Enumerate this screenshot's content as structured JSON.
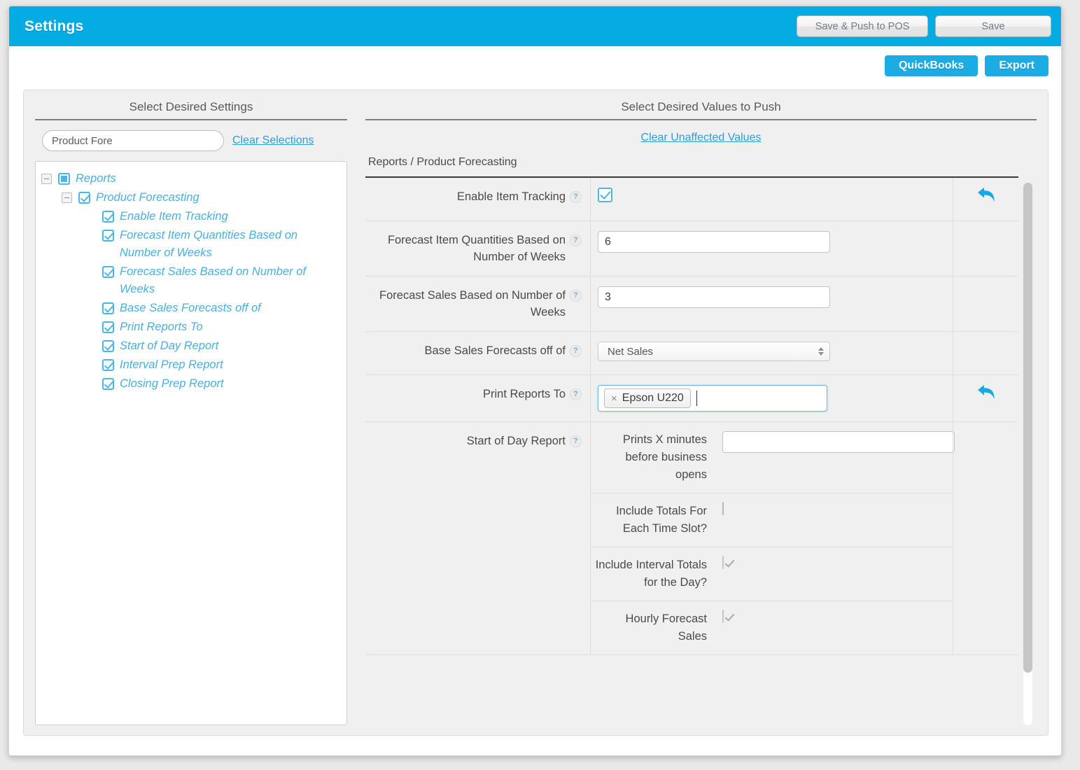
{
  "titlebar": {
    "title": "Settings",
    "save_push_label": "Save & Push to POS",
    "save_label": "Save"
  },
  "subbar": {
    "quickbooks_label": "QuickBooks",
    "export_label": "Export"
  },
  "left": {
    "heading": "Select Desired Settings",
    "search_value": "Product Fore",
    "search_placeholder": "Search settings",
    "clear_selections_label": "Clear Selections",
    "tree": [
      {
        "label": "Reports",
        "depth": 0,
        "state": "partial",
        "expander": "collapse"
      },
      {
        "label": "Product Forecasting",
        "depth": 1,
        "state": "checked",
        "expander": "collapse"
      },
      {
        "label": "Enable Item Tracking",
        "depth": 2,
        "state": "checked",
        "expander": "none"
      },
      {
        "label": "Forecast Item Quantities Based on Number of Weeks",
        "depth": 2,
        "state": "checked",
        "expander": "none"
      },
      {
        "label": "Forecast Sales Based on Number of Weeks",
        "depth": 2,
        "state": "checked",
        "expander": "none"
      },
      {
        "label": "Base Sales Forecasts off of",
        "depth": 2,
        "state": "checked",
        "expander": "none"
      },
      {
        "label": "Print Reports To",
        "depth": 2,
        "state": "checked",
        "expander": "none"
      },
      {
        "label": "Start of Day Report",
        "depth": 2,
        "state": "checked",
        "expander": "none"
      },
      {
        "label": "Interval Prep Report",
        "depth": 2,
        "state": "checked",
        "expander": "none"
      },
      {
        "label": "Closing Prep Report",
        "depth": 2,
        "state": "checked",
        "expander": "none"
      }
    ]
  },
  "right": {
    "heading": "Select Desired Values to Push",
    "clear_unaffected_label": "Clear Unaffected Values",
    "breadcrumb": "Reports / Product Forecasting",
    "help_glyph": "?",
    "rows": {
      "enable_item_tracking": {
        "label": "Enable Item Tracking",
        "checked": true
      },
      "forecast_item_quantities": {
        "label": "Forecast Item Quantities Based on Number of Weeks",
        "value": "6"
      },
      "forecast_sales": {
        "label": "Forecast Sales Based on Number of Weeks",
        "value": "3"
      },
      "base_sales_forecasts": {
        "label": "Base Sales Forecasts off of",
        "value": "Net Sales"
      },
      "print_reports_to": {
        "label": "Print Reports To",
        "tag": "Epson U220",
        "tag_remove": "×",
        "input_value": ""
      },
      "start_of_day_report": {
        "label": "Start of Day Report",
        "subrows": [
          {
            "label": "Prints X minutes before business opens",
            "value": "",
            "kind": "text"
          },
          {
            "label": "Include Totals For Each Time Slot?",
            "kind": "checkbox",
            "checked": false,
            "disabled": false
          },
          {
            "label": "Include Interval Totals for the Day?",
            "kind": "checkbox",
            "checked": true,
            "disabled": true
          },
          {
            "label": "Hourly Forecast Sales",
            "kind": "checkbox",
            "checked": true,
            "disabled": true
          }
        ]
      }
    }
  },
  "colors": {
    "brand_blue": "#04ACE3",
    "link_blue": "#2F9ED6",
    "tree_blue": "#4BAEE0",
    "panel_bg": "#F0F0F0"
  }
}
